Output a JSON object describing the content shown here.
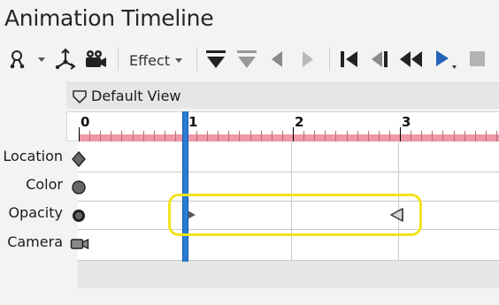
{
  "window": {
    "title": "Animation Timeline"
  },
  "toolbar": {
    "effect_label": "Effect",
    "icons": [
      "path-tool-icon",
      "dropdown-arrow-icon",
      "rig-tool-icon",
      "camera-tool-icon",
      "effect-button",
      "filled-down-triangle-icon",
      "outline-down-triangle-icon",
      "play-backward-icon",
      "play-forward-icon",
      "first-frame-icon",
      "previous-frame-icon",
      "rewind-icon",
      "play-icon",
      "stop-icon"
    ]
  },
  "view": {
    "label": "Default View"
  },
  "ruler": {
    "marks": [
      "0",
      "1",
      "2",
      "3"
    ]
  },
  "tracks": [
    {
      "label": "Location",
      "marker": "diamond"
    },
    {
      "label": "Color",
      "marker": "circle"
    },
    {
      "label": "Opacity",
      "marker": "circle-dot"
    },
    {
      "label": "Camera",
      "marker": "camera"
    }
  ],
  "playhead": {
    "time": 1
  },
  "keyframes": [
    {
      "track": "Opacity",
      "time": 1,
      "shape": "right-triangle"
    },
    {
      "track": "Opacity",
      "time": 2.95,
      "shape": "left-triangle-outline"
    }
  ],
  "colors": {
    "playhead": "#2b7cd3",
    "ruler_strip": "#ef98a8",
    "highlight": "#f2e21c",
    "accent_blue": "#2463b8"
  }
}
